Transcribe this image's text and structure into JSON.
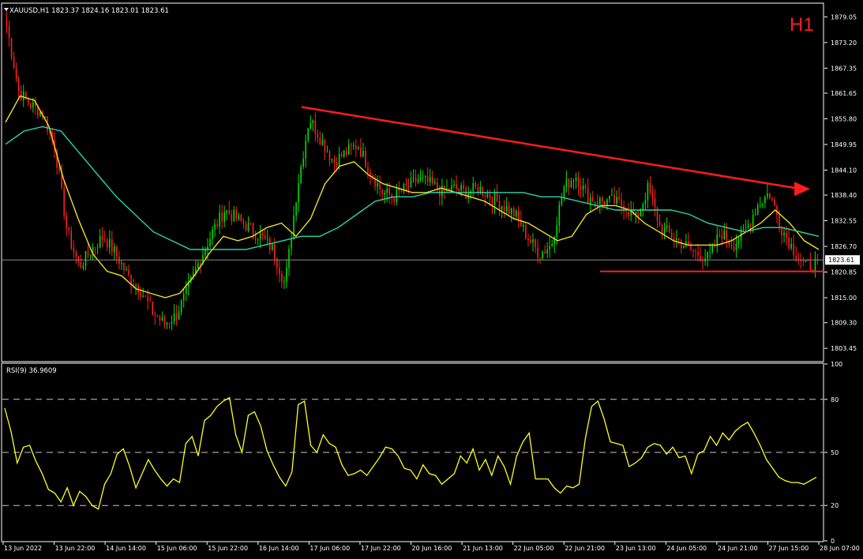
{
  "chart_data": [
    {
      "type": "candlestick",
      "symbol_header": "XAUUSD,H1  1823.37 1824.16 1823.01 1823.61",
      "timeframe_label": "H1",
      "current_price": 1823.61,
      "current_price_label": "1823.61",
      "ylim": [
        1800.6,
        1882.0
      ],
      "y_ticks": [
        "1879.05",
        "1873.20",
        "1867.35",
        "1861.65",
        "1855.80",
        "1849.95",
        "1844.10",
        "1838.40",
        "1832.55",
        "1826.70",
        "1820.85",
        "1815.00",
        "1809.30",
        "1803.45"
      ],
      "x_ticks": [
        "13 Jun 2022",
        "13 Jun 22:00",
        "14 Jun 14:00",
        "15 Jun 06:00",
        "15 Jun 22:00",
        "16 Jun 14:00",
        "17 Jun 06:00",
        "17 Jun 22:00",
        "20 Jun 16:00",
        "21 Jun 13:00",
        "22 Jun 05:00",
        "22 Jun 21:00",
        "23 Jun 13:00",
        "24 Jun 05:00",
        "24 Jun 21:00",
        "27 Jun 15:00",
        "28 Jun 07:00"
      ],
      "close_anchors": [
        1877,
        1862,
        1859,
        1857,
        1849,
        1830,
        1822,
        1826,
        1829,
        1825,
        1820,
        1817,
        1812,
        1809,
        1811,
        1817,
        1824,
        1830,
        1835,
        1833,
        1831,
        1829,
        1826,
        1818,
        1840,
        1856,
        1851,
        1846,
        1848,
        1850,
        1844,
        1839,
        1838,
        1840,
        1842,
        1841,
        1839,
        1840,
        1839,
        1840,
        1838,
        1836,
        1834,
        1829,
        1825,
        1827,
        1840,
        1843,
        1838,
        1837,
        1837,
        1836,
        1833,
        1840,
        1831,
        1829,
        1827,
        1825,
        1824,
        1830,
        1827,
        1830,
        1836,
        1839,
        1831,
        1826,
        1822,
        1823
      ],
      "series": [
        {
          "name": "",
          "kind": "moving_average",
          "color": "#f0e020",
          "values": [
            1855,
            1861,
            1860,
            1854,
            1842,
            1833,
            1825,
            1821,
            1820,
            1817,
            1816,
            1815,
            1816,
            1820,
            1825,
            1829,
            1828,
            1829,
            1831,
            1832,
            1829,
            1833,
            1841,
            1845,
            1846,
            1843,
            1841,
            1840,
            1839,
            1839,
            1840,
            1839,
            1838,
            1837,
            1835,
            1833,
            1832,
            1830,
            1828,
            1829,
            1834,
            1836,
            1836,
            1835,
            1832,
            1830,
            1828,
            1827,
            1827,
            1827,
            1828,
            1830,
            1832,
            1835,
            1832,
            1828,
            1826
          ]
        },
        {
          "name": "",
          "kind": "moving_average",
          "color": "#2ad6a6",
          "values": [
            1850,
            1853,
            1854,
            1853,
            1848,
            1843,
            1838,
            1834,
            1830,
            1828,
            1826,
            1826,
            1826,
            1826,
            1827,
            1828,
            1829,
            1829,
            1831,
            1834,
            1837,
            1838,
            1838,
            1839,
            1839,
            1839,
            1839,
            1839,
            1839,
            1838,
            1838,
            1837,
            1836,
            1835,
            1835,
            1835,
            1835,
            1834,
            1832,
            1831,
            1830,
            1831,
            1831,
            1830,
            1829
          ]
        }
      ],
      "annotations": [
        {
          "kind": "trendline_arrow",
          "color": "#ff1c1c",
          "from_price": 1858.5,
          "to_price": 1840.0
        },
        {
          "kind": "support_line",
          "color": "#ff1c1c",
          "price": 1821.0
        }
      ],
      "colors": {
        "bull": "#00e000",
        "bear": "#ff2020",
        "grid": "#ffffff",
        "background": "#000000"
      }
    },
    {
      "type": "line",
      "indicator_header": "RSI(9) 36.9609",
      "ylim": [
        0,
        100
      ],
      "y_ticks": [
        "100",
        "80",
        "50",
        "20",
        "0"
      ],
      "levels": [
        80,
        50,
        20
      ],
      "series": [
        {
          "name": "RSI(9)",
          "color": "#ffff22",
          "values": [
            75,
            62,
            44,
            53,
            54,
            45,
            38,
            29,
            27,
            22,
            30,
            20,
            28,
            25,
            20,
            18,
            32,
            38,
            49,
            52,
            42,
            30,
            38,
            46,
            40,
            35,
            31,
            35,
            33,
            55,
            59,
            48,
            68,
            71,
            76,
            79,
            81,
            60,
            50,
            71,
            73,
            65,
            51,
            43,
            36,
            31,
            39,
            77,
            79,
            54,
            50,
            60,
            55,
            53,
            43,
            37,
            38,
            40,
            37,
            42,
            47,
            53,
            52,
            48,
            41,
            40,
            35,
            43,
            38,
            37,
            32,
            35,
            38,
            48,
            44,
            52,
            40,
            46,
            37,
            48,
            42,
            32,
            48,
            56,
            61,
            35,
            35,
            35,
            30,
            27,
            31,
            30,
            32,
            58,
            76,
            79,
            69,
            56,
            55,
            54,
            42,
            44,
            47,
            53,
            55,
            54,
            49,
            53,
            47,
            48,
            38,
            49,
            51,
            59,
            54,
            61,
            57,
            62,
            65,
            67,
            61,
            54,
            46,
            41,
            36,
            34,
            33,
            33,
            32,
            34,
            36
          ]
        }
      ],
      "last_value": 36.9609
    }
  ]
}
